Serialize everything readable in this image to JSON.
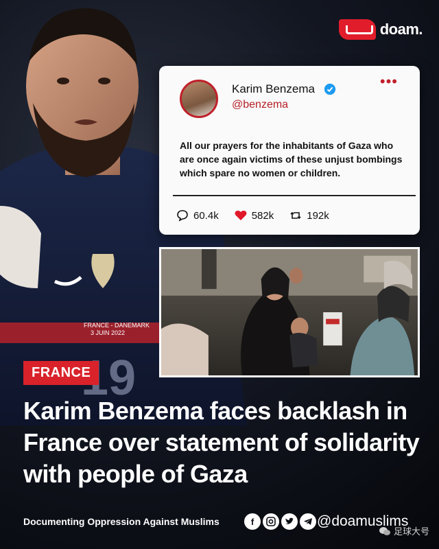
{
  "brand": {
    "logo_text": "doam."
  },
  "tweet": {
    "name": "Karim Benzema",
    "handle": "@benzema",
    "text": "All our prayers for the inhabitants of Gaza who are once again victims of these unjust bombings which spare no women or children.",
    "replies": "60.4k",
    "likes": "582k",
    "retweets": "192k"
  },
  "jersey_text": {
    "line1": "FRANCE - DANEMARK",
    "line2": "3 JUIN 2022",
    "number": "19"
  },
  "tag": "FRANCE",
  "headline": "Karim Benzema faces backlash in France over statement of solidarity with people of Gaza",
  "footer": {
    "tagline": "Documenting Oppression Against Muslims",
    "handle": "@doamuslims",
    "watermark": "足球大号"
  },
  "colors": {
    "accent": "#d9222a",
    "background": "#0b0d14",
    "card": "#fafafa"
  }
}
